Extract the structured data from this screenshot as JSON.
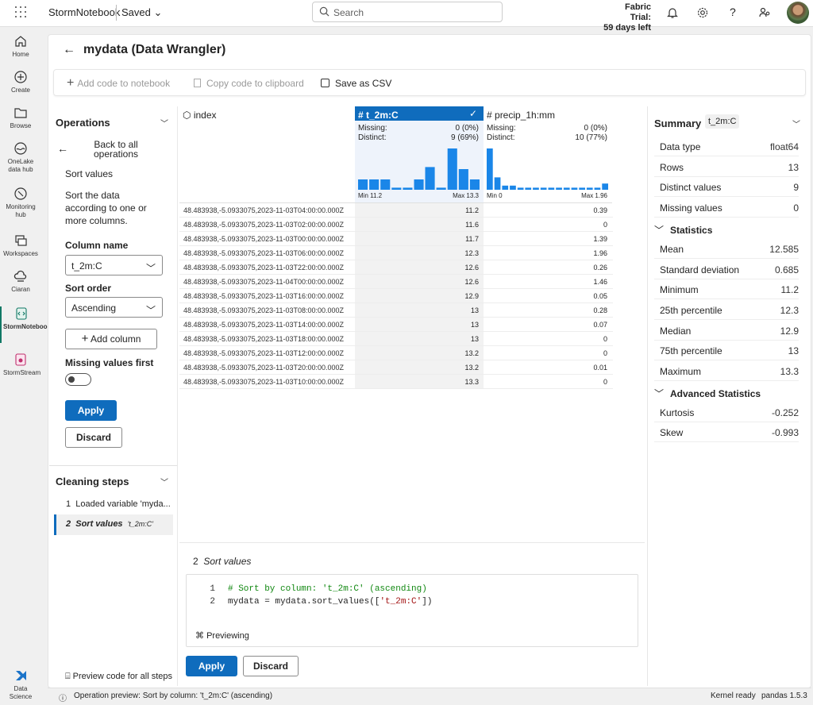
{
  "app": {
    "name": "StormNotebook",
    "saved": "Saved",
    "search_placeholder": "Search",
    "trial_line1": "Fabric Trial:",
    "trial_line2": "59 days left"
  },
  "nav": [
    {
      "label": "Home",
      "icon": "home-icon"
    },
    {
      "label": "Create",
      "icon": "plus-circle-icon"
    },
    {
      "label": "Browse",
      "icon": "folder-icon"
    },
    {
      "label": "OneLake data hub",
      "icon": "onelake-icon"
    },
    {
      "label": "Monitoring hub",
      "icon": "monitor-icon"
    },
    {
      "label": "Workspaces",
      "icon": "workspaces-icon"
    },
    {
      "label": "Ciaran",
      "icon": "cloud-workspace-icon"
    },
    {
      "label": "StormNotebook",
      "icon": "notebook-icon"
    },
    {
      "label": "StormStream",
      "icon": "stream-icon"
    },
    {
      "label": "Data Science",
      "icon": "data-science-icon"
    }
  ],
  "page": {
    "title": "mydata (Data Wrangler)"
  },
  "toolbar": {
    "add_code": "Add code to notebook",
    "copy_code": "Copy code to clipboard",
    "save_csv": "Save as CSV"
  },
  "operations": {
    "header": "Operations",
    "back": "Back to all operations",
    "op_title": "Sort values",
    "description": "Sort the data according to one or more columns.",
    "column_name_label": "Column name",
    "column_value": "t_2m:C",
    "sort_order_label": "Sort order",
    "sort_order_value": "Ascending",
    "add_column": "Add column",
    "missing_first": "Missing values first",
    "apply": "Apply",
    "discard": "Discard"
  },
  "cleaning": {
    "header": "Cleaning steps",
    "steps": [
      {
        "num": "1",
        "label": "Loaded variable 'myda..."
      },
      {
        "num": "2",
        "label": "Sort values",
        "sub": "'t_2m:C'"
      }
    ],
    "preview_all": "Preview code for all steps"
  },
  "grid": {
    "columns": [
      {
        "name": "index"
      },
      {
        "name": "t_2m:C",
        "missing_label": "Missing:",
        "missing": "0 (0%)",
        "distinct_label": "Distinct:",
        "distinct": "9 (69%)",
        "min": "Min 11.2",
        "max": "Max 13.3",
        "hist": [
          0.25,
          0.25,
          0.25,
          0.05,
          0.05,
          0.25,
          0.55,
          0.05,
          1.0,
          0.5,
          0.25
        ]
      },
      {
        "name": "precip_1h:mm",
        "missing_label": "Missing:",
        "missing": "0 (0%)",
        "distinct_label": "Distinct:",
        "distinct": "10 (77%)",
        "min": "Min 0",
        "max": "Max 1.96",
        "hist": [
          1.0,
          0.3,
          0.1,
          0.1,
          0.05,
          0.05,
          0.05,
          0.05,
          0.05,
          0.05,
          0.05,
          0.05,
          0.05,
          0.05,
          0.05,
          0.15
        ]
      }
    ],
    "rows": [
      [
        "48.483938,-5.0933075,2023-11-03T04:00:00.000Z",
        "11.2",
        "0.39"
      ],
      [
        "48.483938,-5.0933075,2023-11-03T02:00:00.000Z",
        "11.6",
        "0"
      ],
      [
        "48.483938,-5.0933075,2023-11-03T00:00:00.000Z",
        "11.7",
        "1.39"
      ],
      [
        "48.483938,-5.0933075,2023-11-03T06:00:00.000Z",
        "12.3",
        "1.96"
      ],
      [
        "48.483938,-5.0933075,2023-11-03T22:00:00.000Z",
        "12.6",
        "0.26"
      ],
      [
        "48.483938,-5.0933075,2023-11-04T00:00:00.000Z",
        "12.6",
        "1.46"
      ],
      [
        "48.483938,-5.0933075,2023-11-03T16:00:00.000Z",
        "12.9",
        "0.05"
      ],
      [
        "48.483938,-5.0933075,2023-11-03T08:00:00.000Z",
        "13",
        "0.28"
      ],
      [
        "48.483938,-5.0933075,2023-11-03T14:00:00.000Z",
        "13",
        "0.07"
      ],
      [
        "48.483938,-5.0933075,2023-11-03T18:00:00.000Z",
        "13",
        "0"
      ],
      [
        "48.483938,-5.0933075,2023-11-03T12:00:00.000Z",
        "13.2",
        "0"
      ],
      [
        "48.483938,-5.0933075,2023-11-03T20:00:00.000Z",
        "13.2",
        "0.01"
      ],
      [
        "48.483938,-5.0933075,2023-11-03T10:00:00.000Z",
        "13.3",
        "0"
      ]
    ]
  },
  "preview": {
    "step_num": "2",
    "step_name": "Sort values",
    "code": [
      {
        "n": "1",
        "comment": "# Sort by column: 't_2m:C' (ascending)"
      },
      {
        "n": "2",
        "pre": "mydata = mydata.sort_values([",
        "str": "'t_2m:C'",
        "post": "])"
      }
    ],
    "previewing": "Previewing",
    "apply": "Apply",
    "discard": "Discard"
  },
  "summary": {
    "header": "Summary",
    "column": "t_2m:C",
    "basic": [
      {
        "k": "Data type",
        "v": "float64"
      },
      {
        "k": "Rows",
        "v": "13"
      },
      {
        "k": "Distinct values",
        "v": "9"
      },
      {
        "k": "Missing values",
        "v": "0"
      }
    ],
    "stats_header": "Statistics",
    "stats": [
      {
        "k": "Mean",
        "v": "12.585"
      },
      {
        "k": "Standard deviation",
        "v": "0.685"
      },
      {
        "k": "Minimum",
        "v": "11.2"
      },
      {
        "k": "25th percentile",
        "v": "12.3"
      },
      {
        "k": "Median",
        "v": "12.9"
      },
      {
        "k": "75th percentile",
        "v": "13"
      },
      {
        "k": "Maximum",
        "v": "13.3"
      }
    ],
    "adv_header": "Advanced Statistics",
    "adv": [
      {
        "k": "Kurtosis",
        "v": "-0.252"
      },
      {
        "k": "Skew",
        "v": "-0.993"
      }
    ]
  },
  "status": {
    "message": "Operation preview: Sort by column: 't_2m:C' (ascending)",
    "kernel": "Kernel ready",
    "pandas": "pandas 1.5.3"
  },
  "colors": {
    "accent": "#0f6cbd",
    "hist_bar": "#1a86e8"
  }
}
